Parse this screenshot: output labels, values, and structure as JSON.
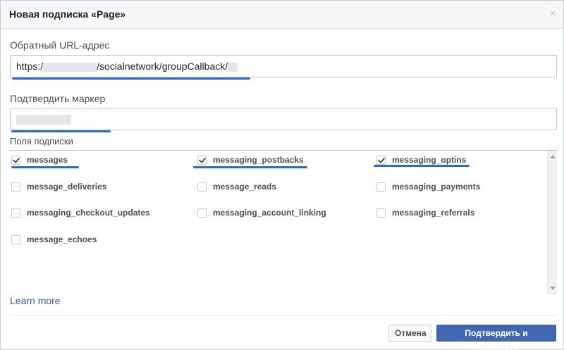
{
  "dialog": {
    "title": "Новая подписка «Page»",
    "close_glyph": "×"
  },
  "callback_url": {
    "label": "Обратный URL-адрес",
    "value_prefix": "https:/",
    "value_middle": "/socialnetwork/groupCallback/",
    "value_suffix": ""
  },
  "verify_token": {
    "label": "Подтвердить маркер",
    "value": ""
  },
  "subscription_fields": {
    "label": "Поля подписки",
    "items": [
      {
        "name": "messages",
        "checked": true
      },
      {
        "name": "messaging_postbacks",
        "checked": true
      },
      {
        "name": "messaging_optins",
        "checked": true
      },
      {
        "name": "message_deliveries",
        "checked": false
      },
      {
        "name": "message_reads",
        "checked": false
      },
      {
        "name": "messaging_payments",
        "checked": false
      },
      {
        "name": "messaging_checkout_updates",
        "checked": false
      },
      {
        "name": "messaging_account_linking",
        "checked": false
      },
      {
        "name": "messaging_referrals",
        "checked": false
      },
      {
        "name": "message_echoes",
        "checked": false
      }
    ]
  },
  "learn_more": "Learn more",
  "footer": {
    "cancel_label": "Отмена",
    "save_label": "Подтвердить и сохранить"
  },
  "colors": {
    "primary_button": "#4267b2",
    "link": "#365899",
    "annotation_underline": "#2d6cc0"
  }
}
